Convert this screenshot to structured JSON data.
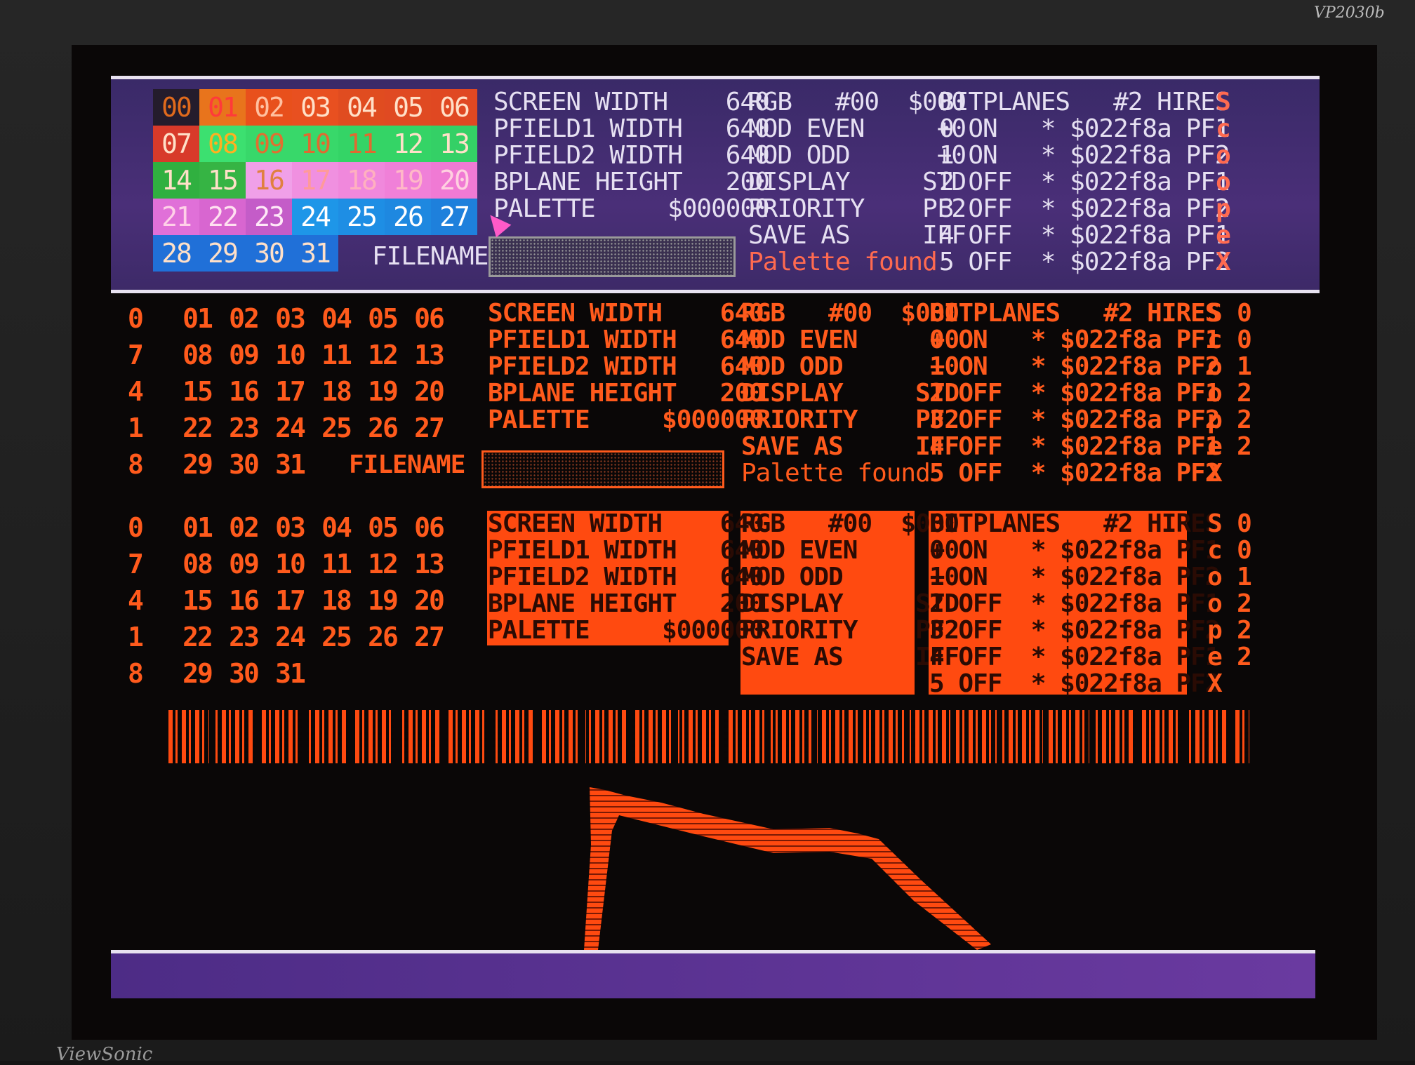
{
  "monitor": {
    "model": "VP2030b",
    "maker": "ViewSonic"
  },
  "palette": {
    "rows": [
      [
        "00",
        "01",
        "02",
        "03",
        "04",
        "05",
        "06"
      ],
      [
        "07",
        "08",
        "09",
        "10",
        "11",
        "12",
        "13"
      ],
      [
        "14",
        "15",
        "16",
        "17",
        "18",
        "19",
        "20"
      ],
      [
        "21",
        "22",
        "23",
        "24",
        "25",
        "26",
        "27"
      ],
      [
        "28",
        "29",
        "30",
        "31"
      ]
    ],
    "bottom_rows_left_cropped": [
      [
        "0",
        "01",
        "02",
        "03",
        "04",
        "05",
        "06"
      ],
      [
        "7",
        "08",
        "09",
        "10",
        "11",
        "12",
        "13"
      ],
      [
        "4",
        "15",
        "16",
        "17",
        "18",
        "19",
        "20"
      ],
      [
        "1",
        "22",
        "23",
        "24",
        "25",
        "26",
        "27"
      ],
      [
        "8",
        "29",
        "30",
        "31"
      ]
    ]
  },
  "settings": {
    "lines": [
      "SCREEN WIDTH    640",
      "PFIELD1 WIDTH   640",
      "PFIELD2 WIDTH   640",
      "BPLANE HEIGHT   200",
      "PALETTE     $000000"
    ]
  },
  "regs": {
    "lines": [
      "RGB   #00  $000",
      "MOD EVEN     +0",
      "MOD ODD      +0",
      "DISPLAY     STD",
      "PRIORITY    PF2",
      "SAVE AS     IFF"
    ],
    "status": "Palette found"
  },
  "bitplanes": {
    "lines": [
      "BITPLANES   #2 HIRES",
      "0 ON   * $022f8a PF1",
      "1 ON   * $022f8a PF2",
      "2 OFF  * $022f8a PF1",
      "3 OFF  * $022f8a PF2",
      "4 OFF  * $022f8a PF1",
      "5 OFF  * $022f8a PF2"
    ]
  },
  "filename_label": "FILENAME",
  "logo_letters": [
    "S",
    "c",
    "o",
    "o",
    "p",
    "e",
    "X"
  ],
  "side_digits": [
    "0",
    "0",
    "1",
    "2",
    "2",
    "2"
  ],
  "colors": {
    "purple": "#4a2f78",
    "orange": "#ff4a10",
    "text_light": "#e6e0f2"
  }
}
